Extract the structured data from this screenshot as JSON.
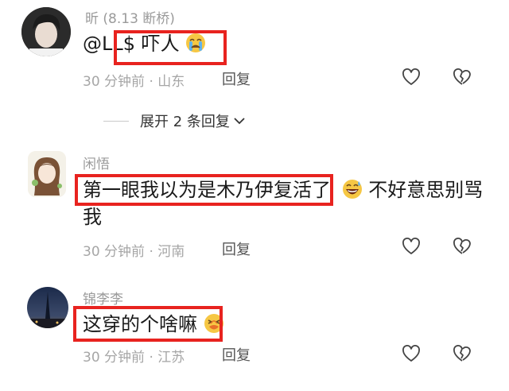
{
  "comments": [
    {
      "username": "昕 (8.13 断桥)",
      "mention": "@LL$",
      "text": "吓人",
      "emoji": "crying-face-icon",
      "time": "30 分钟前",
      "location": "山东",
      "reply_label": "回复",
      "expand_replies": "展开 2 条回复"
    },
    {
      "username": "闲悟",
      "highlighted_text": "第一眼我以为是木乃伊复活了",
      "emoji": "grinning-sweat-face-icon",
      "text_after": "不好意思别骂",
      "text_line2": "我",
      "time": "30 分钟前",
      "location": "河南",
      "reply_label": "回复"
    },
    {
      "username": "锦李李",
      "text": "这穿的个啥嘛",
      "emoji": "grimacing-face-icon",
      "time": "30 分钟前",
      "location": "江苏",
      "reply_label": "回复"
    }
  ],
  "meta_separator": "·",
  "colors": {
    "highlight_box": "#e8231f",
    "username": "#9a9a9a",
    "meta": "#a6a6a6"
  }
}
